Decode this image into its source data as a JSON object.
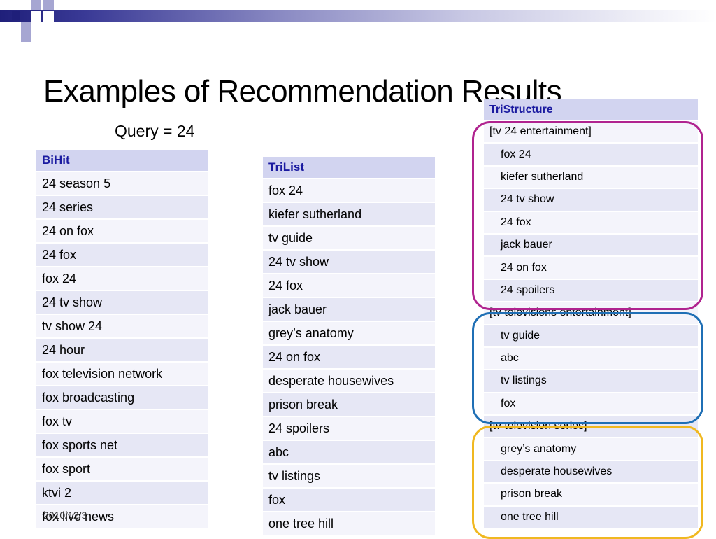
{
  "slide": {
    "title": "Examples of Recommendation Results",
    "subtitle": "Query = 24",
    "date": "2010/12/3"
  },
  "bihit": {
    "header": "BiHit",
    "items": [
      "24 season 5",
      "24 series",
      "24 on fox",
      "24 fox",
      "fox 24",
      "24 tv show",
      "tv show 24",
      "24 hour",
      "fox television network",
      "fox broadcasting",
      "fox tv",
      "fox sports net",
      "fox sport",
      "ktvi 2",
      "fox live news"
    ]
  },
  "trilist": {
    "header": "TriList",
    "items": [
      "fox 24",
      "kiefer sutherland",
      "tv guide",
      "24 tv show",
      "24 fox",
      "jack bauer",
      "grey’s anatomy",
      "24 on fox",
      "desperate housewives",
      "prison break",
      "24 spoilers",
      "abc",
      "tv listings",
      "fox",
      "one tree hill"
    ]
  },
  "tristructure": {
    "header": "TriStructure",
    "groups": [
      {
        "label": "[tv 24 entertainment]",
        "items": [
          "fox 24",
          "kiefer sutherland",
          "24 tv show",
          "24 fox",
          "jack bauer",
          "24 on fox",
          "24 spoilers"
        ],
        "color": "#b0238f"
      },
      {
        "label": "[tv televisions entertainment]",
        "items": [
          "tv guide",
          "abc",
          "tv listings",
          "fox"
        ],
        "color": "#1f6fb5"
      },
      {
        "label": "[tv television series]",
        "items": [
          "grey’s anatomy",
          "desperate housewives",
          "prison break",
          "one tree hill"
        ],
        "color": "#f0b820"
      }
    ]
  },
  "colors": {
    "header_bg": "#d2d4f0",
    "header_text": "#1a1aa0",
    "deco_navy": "#1f1f7a",
    "deco_light": "#a6a6d2"
  }
}
